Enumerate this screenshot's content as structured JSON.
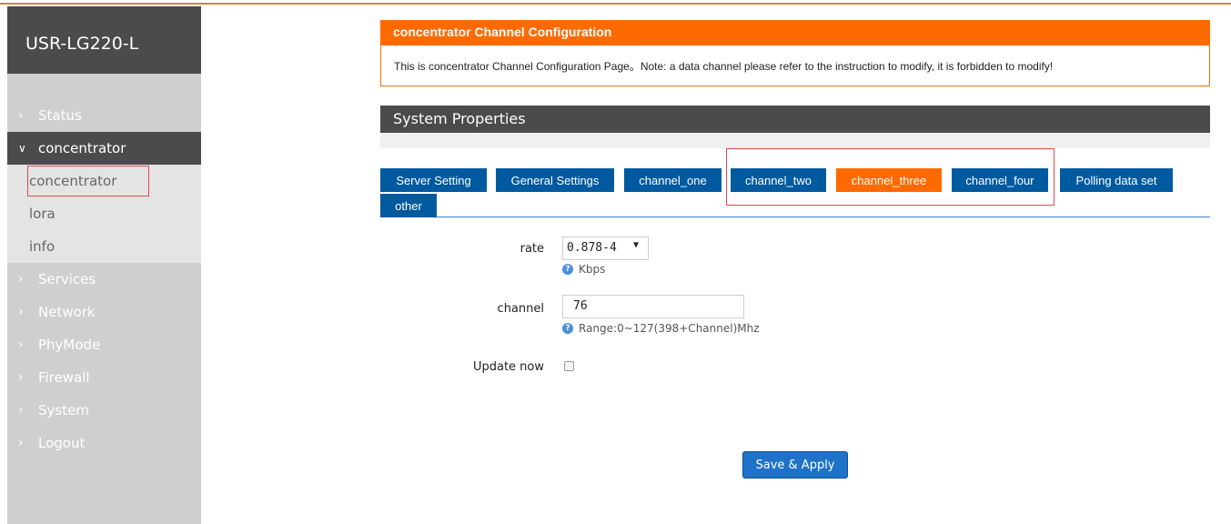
{
  "sidebar": {
    "brand": "USR-LG220-L",
    "items": [
      {
        "label": "Status"
      },
      {
        "label": "concentrator"
      },
      {
        "label": "Services"
      },
      {
        "label": "Network"
      },
      {
        "label": "PhyMode"
      },
      {
        "label": "Firewall"
      },
      {
        "label": "System"
      },
      {
        "label": "Logout"
      }
    ],
    "subitems": [
      {
        "label": "concentrator"
      },
      {
        "label": "lora"
      },
      {
        "label": "info"
      }
    ]
  },
  "config": {
    "title": "concentrator Channel Configuration",
    "description": "This is concentrator Channel Configuration Page。Note: a data channel please refer to the instruction to modify, it is forbidden to modify!"
  },
  "system": {
    "title": "System Properties"
  },
  "tabs": [
    {
      "label": "Server Setting"
    },
    {
      "label": "General Settings"
    },
    {
      "label": "channel_one"
    },
    {
      "label": "channel_two"
    },
    {
      "label": "channel_three"
    },
    {
      "label": "channel_four"
    },
    {
      "label": "Polling data set"
    },
    {
      "label": "other"
    }
  ],
  "form": {
    "rate_label": "rate",
    "rate_value": "0.878-4",
    "rate_hint": "Kbps",
    "channel_label": "channel",
    "channel_value": "76",
    "channel_hint": "Range:0~127(398+Channel)Mhz",
    "update_label": "Update now"
  },
  "actions": {
    "save_label": "Save & Apply"
  },
  "colors": {
    "accent_orange": "#ff6a00",
    "tab_blue": "#005aa0",
    "dark_header": "#4b4b4b",
    "highlight_red": "#e24a4a"
  }
}
